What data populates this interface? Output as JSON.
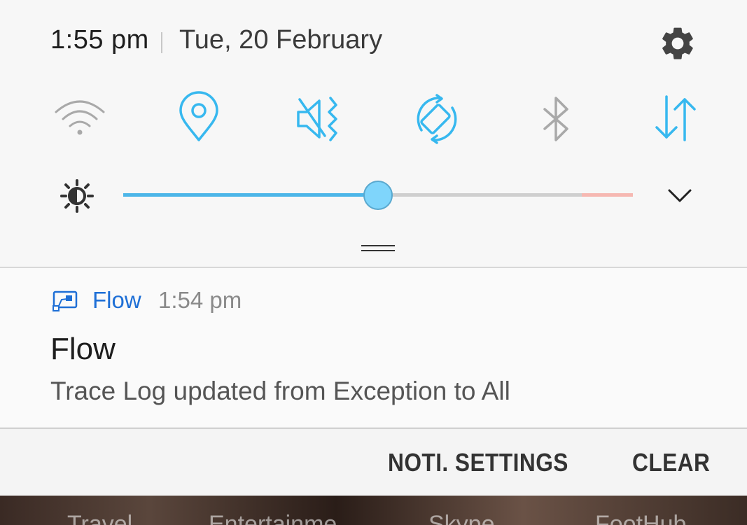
{
  "status": {
    "time": "1:55 pm",
    "date": "Tue, 20 February"
  },
  "quick_settings": [
    {
      "name": "wifi",
      "icon": "wifi-icon",
      "active": false
    },
    {
      "name": "location",
      "icon": "location-pin-icon",
      "active": true
    },
    {
      "name": "sound",
      "icon": "vibrate-mute-icon",
      "active": true
    },
    {
      "name": "auto-rotate",
      "icon": "rotate-icon",
      "active": true
    },
    {
      "name": "bluetooth",
      "icon": "bluetooth-icon",
      "active": false
    },
    {
      "name": "mobile-data",
      "icon": "data-transfer-icon",
      "active": true
    }
  ],
  "brightness": {
    "level": 0.5,
    "warn_start": 0.9
  },
  "colors": {
    "accent": "#37b8ef",
    "inactive": "#a9a9a9",
    "app": "#1e6fd6",
    "warn": "#f6b8b2"
  },
  "notification": {
    "app_name": "Flow",
    "time": "1:54 pm",
    "title": "Flow",
    "body": "Trace Log updated from Exception to All"
  },
  "actions": {
    "noti_settings": "NOTI. SETTINGS",
    "clear": "CLEAR"
  },
  "background_tabs": [
    "Travel",
    "Entertainme",
    "Skype",
    "FootHub"
  ]
}
